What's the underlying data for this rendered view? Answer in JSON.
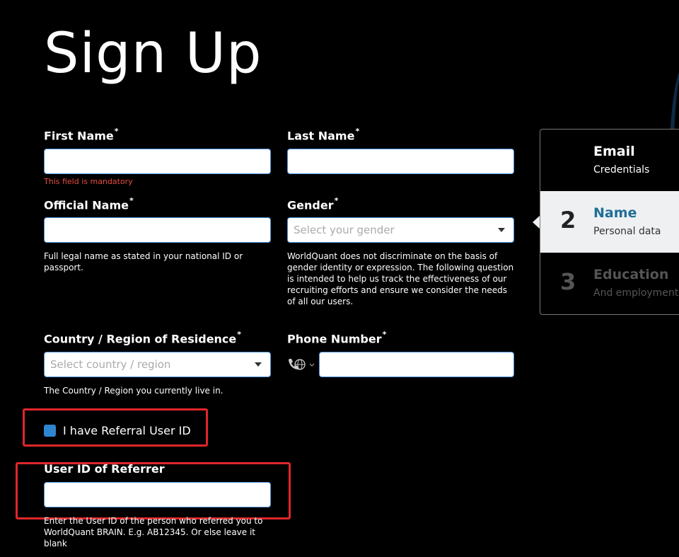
{
  "page": {
    "title": "Sign Up"
  },
  "form": {
    "first_name": {
      "label": "First Name",
      "required": "*",
      "value": "",
      "error": "This field is mandatory"
    },
    "last_name": {
      "label": "Last Name",
      "required": "*",
      "value": ""
    },
    "official_name": {
      "label": "Official Name",
      "required": "*",
      "value": "",
      "help": "Full legal name as stated in your national ID or passport."
    },
    "gender": {
      "label": "Gender",
      "required": "*",
      "placeholder": "Select your gender",
      "help": "WorldQuant does not discriminate on the basis of gender identity or expression. The following question is intended to help us track the effectiveness of our recruiting efforts and ensure we consider the needs of all our users."
    },
    "country": {
      "label": "Country / Region of Residence",
      "required": "*",
      "placeholder": "Select country / region",
      "help": "The Country / Region you currently live in."
    },
    "phone": {
      "label": "Phone Number",
      "required": "*",
      "value": "",
      "icon": "phone-globe-icon"
    },
    "referral_checkbox": {
      "label": "I have Referral User ID",
      "checked": true
    },
    "referrer_id": {
      "label": "User ID of Referrer",
      "value": "",
      "help": "Enter the User ID of the person who referred you to WorldQuant BRAIN. E.g. AB12345. Or else leave it blank"
    }
  },
  "steps": [
    {
      "number": "",
      "title": "Email",
      "subtitle": "Credentials",
      "state": "done"
    },
    {
      "number": "2",
      "title": "Name",
      "subtitle": "Personal data",
      "state": "active"
    },
    {
      "number": "3",
      "title": "Education",
      "subtitle": "And employment",
      "state": "pending"
    }
  ],
  "colors": {
    "accent": "#2e86d1",
    "active_step_title": "#1f6e98",
    "error": "#e74c3c",
    "highlight_box": "#e0262b"
  }
}
